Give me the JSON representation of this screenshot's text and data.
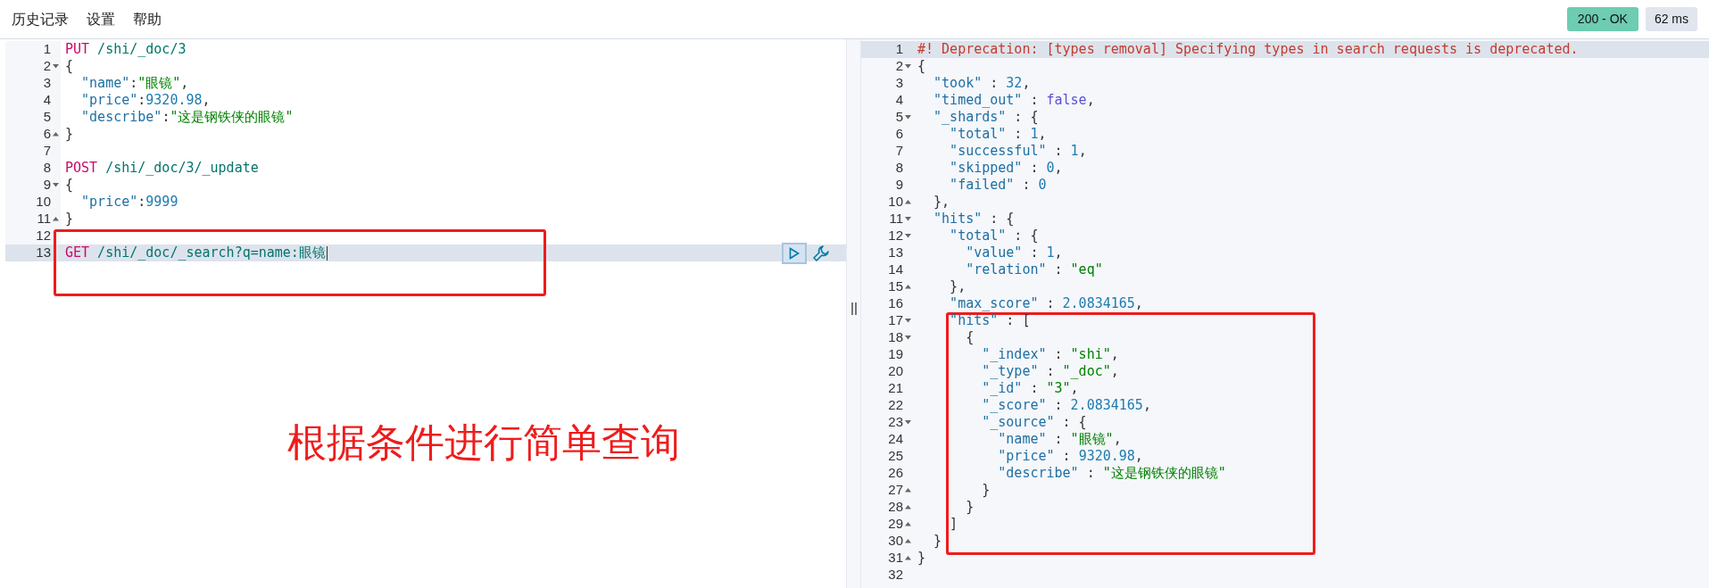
{
  "menu": [
    {
      "label": "历史记录"
    },
    {
      "label": "设置"
    },
    {
      "label": "帮助"
    }
  ],
  "status": {
    "code": "200 - OK",
    "time": "62 ms"
  },
  "request": {
    "lines": [
      {
        "num": "1",
        "active": false,
        "kind": "plain",
        "tokens": [
          {
            "kind": "method",
            "text": "PUT"
          },
          {
            "kind": "path",
            "text": " /shi/_doc/3"
          }
        ]
      },
      {
        "num": "2",
        "active": false,
        "kind": "fold-start",
        "tokens": [
          {
            "kind": "punct",
            "text": "{"
          }
        ]
      },
      {
        "num": "3",
        "active": false,
        "kind": "plain",
        "tokens": [
          {
            "kind": "key",
            "text": "  \"name\""
          },
          {
            "kind": "punct",
            "text": ":"
          },
          {
            "kind": "string",
            "text": "\"眼镜\""
          },
          {
            "kind": "punct",
            "text": ","
          }
        ]
      },
      {
        "num": "4",
        "active": false,
        "kind": "plain",
        "tokens": [
          {
            "kind": "key",
            "text": "  \"price\""
          },
          {
            "kind": "punct",
            "text": ":"
          },
          {
            "kind": "number",
            "text": "9320.98"
          },
          {
            "kind": "punct",
            "text": ","
          }
        ]
      },
      {
        "num": "5",
        "active": false,
        "kind": "plain",
        "tokens": [
          {
            "kind": "key",
            "text": "  \"describe\""
          },
          {
            "kind": "punct",
            "text": ":"
          },
          {
            "kind": "string",
            "text": "\"这是钢铁侠的眼镜\""
          }
        ]
      },
      {
        "num": "6",
        "active": false,
        "kind": "fold-end",
        "tokens": [
          {
            "kind": "punct",
            "text": "}"
          }
        ]
      },
      {
        "num": "7",
        "active": false,
        "kind": "plain"
      },
      {
        "num": "8",
        "active": false,
        "kind": "plain",
        "tokens": [
          {
            "kind": "method",
            "text": "POST"
          },
          {
            "kind": "path",
            "text": " /shi/_doc/3/_update"
          }
        ]
      },
      {
        "num": "9",
        "active": false,
        "kind": "fold-start",
        "tokens": [
          {
            "kind": "punct",
            "text": "{"
          }
        ]
      },
      {
        "num": "10",
        "active": false,
        "kind": "plain",
        "tokens": [
          {
            "kind": "key",
            "text": "  \"price\""
          },
          {
            "kind": "punct",
            "text": ":"
          },
          {
            "kind": "number",
            "text": "9999"
          }
        ]
      },
      {
        "num": "11",
        "active": false,
        "kind": "fold-end",
        "tokens": [
          {
            "kind": "punct",
            "text": "}"
          }
        ]
      },
      {
        "num": "12",
        "active": false,
        "kind": "plain"
      },
      {
        "num": "13",
        "active": true,
        "actions": true,
        "kind": "plain",
        "tokens": [
          {
            "kind": "method",
            "text": "GET"
          },
          {
            "kind": "path",
            "text": " /shi/_doc/_search?q=name:眼镜"
          }
        ]
      }
    ]
  },
  "response": {
    "lines": [
      {
        "num": "1",
        "active": true,
        "kind": "plain",
        "tokens": [
          {
            "kind": "comment",
            "text": "#! Deprecation: [types removal] Specifying types in search requests is deprecated."
          }
        ]
      },
      {
        "num": "2",
        "active": false,
        "kind": "fold-start",
        "tokens": [
          {
            "kind": "punct",
            "text": "{"
          }
        ]
      },
      {
        "num": "3",
        "active": false,
        "kind": "plain",
        "tokens": [
          {
            "kind": "key",
            "text": "  \"took\""
          },
          {
            "kind": "punct",
            "text": " : "
          },
          {
            "kind": "number",
            "text": "32"
          },
          {
            "kind": "punct",
            "text": ","
          }
        ]
      },
      {
        "num": "4",
        "active": false,
        "kind": "plain",
        "tokens": [
          {
            "kind": "key",
            "text": "  \"timed_out\""
          },
          {
            "kind": "punct",
            "text": " : "
          },
          {
            "kind": "bool",
            "text": "false"
          },
          {
            "kind": "punct",
            "text": ","
          }
        ]
      },
      {
        "num": "5",
        "active": false,
        "kind": "fold-start",
        "tokens": [
          {
            "kind": "key",
            "text": "  \"_shards\""
          },
          {
            "kind": "punct",
            "text": " : {"
          }
        ]
      },
      {
        "num": "6",
        "active": false,
        "kind": "plain",
        "tokens": [
          {
            "kind": "key",
            "text": "    \"total\""
          },
          {
            "kind": "punct",
            "text": " : "
          },
          {
            "kind": "number",
            "text": "1"
          },
          {
            "kind": "punct",
            "text": ","
          }
        ]
      },
      {
        "num": "7",
        "active": false,
        "kind": "plain",
        "tokens": [
          {
            "kind": "key",
            "text": "    \"successful\""
          },
          {
            "kind": "punct",
            "text": " : "
          },
          {
            "kind": "number",
            "text": "1"
          },
          {
            "kind": "punct",
            "text": ","
          }
        ]
      },
      {
        "num": "8",
        "active": false,
        "kind": "plain",
        "tokens": [
          {
            "kind": "key",
            "text": "    \"skipped\""
          },
          {
            "kind": "punct",
            "text": " : "
          },
          {
            "kind": "number",
            "text": "0"
          },
          {
            "kind": "punct",
            "text": ","
          }
        ]
      },
      {
        "num": "9",
        "active": false,
        "kind": "plain",
        "tokens": [
          {
            "kind": "key",
            "text": "    \"failed\""
          },
          {
            "kind": "punct",
            "text": " : "
          },
          {
            "kind": "number",
            "text": "0"
          }
        ]
      },
      {
        "num": "10",
        "active": false,
        "kind": "fold-end",
        "tokens": [
          {
            "kind": "punct",
            "text": "  },"
          }
        ]
      },
      {
        "num": "11",
        "active": false,
        "kind": "fold-start",
        "tokens": [
          {
            "kind": "key",
            "text": "  \"hits\""
          },
          {
            "kind": "punct",
            "text": " : {"
          }
        ]
      },
      {
        "num": "12",
        "active": false,
        "kind": "fold-start",
        "tokens": [
          {
            "kind": "key",
            "text": "    \"total\""
          },
          {
            "kind": "punct",
            "text": " : {"
          }
        ]
      },
      {
        "num": "13",
        "active": false,
        "kind": "plain",
        "tokens": [
          {
            "kind": "key",
            "text": "      \"value\""
          },
          {
            "kind": "punct",
            "text": " : "
          },
          {
            "kind": "number",
            "text": "1"
          },
          {
            "kind": "punct",
            "text": ","
          }
        ]
      },
      {
        "num": "14",
        "active": false,
        "kind": "plain",
        "tokens": [
          {
            "kind": "key",
            "text": "      \"relation\""
          },
          {
            "kind": "punct",
            "text": " : "
          },
          {
            "kind": "string",
            "text": "\"eq\""
          }
        ]
      },
      {
        "num": "15",
        "active": false,
        "kind": "fold-end",
        "tokens": [
          {
            "kind": "punct",
            "text": "    },"
          }
        ]
      },
      {
        "num": "16",
        "active": false,
        "kind": "plain",
        "tokens": [
          {
            "kind": "key",
            "text": "    \"max_score\""
          },
          {
            "kind": "punct",
            "text": " : "
          },
          {
            "kind": "number",
            "text": "2.0834165"
          },
          {
            "kind": "punct",
            "text": ","
          }
        ]
      },
      {
        "num": "17",
        "active": false,
        "kind": "fold-start",
        "tokens": [
          {
            "kind": "key",
            "text": "    \"hits\""
          },
          {
            "kind": "punct",
            "text": " : ["
          }
        ]
      },
      {
        "num": "18",
        "active": false,
        "kind": "fold-start",
        "tokens": [
          {
            "kind": "punct",
            "text": "      {"
          }
        ]
      },
      {
        "num": "19",
        "active": false,
        "kind": "plain",
        "tokens": [
          {
            "kind": "key",
            "text": "        \"_index\""
          },
          {
            "kind": "punct",
            "text": " : "
          },
          {
            "kind": "string",
            "text": "\"shi\""
          },
          {
            "kind": "punct",
            "text": ","
          }
        ]
      },
      {
        "num": "20",
        "active": false,
        "kind": "plain",
        "tokens": [
          {
            "kind": "key",
            "text": "        \"_type\""
          },
          {
            "kind": "punct",
            "text": " : "
          },
          {
            "kind": "string",
            "text": "\"_doc\""
          },
          {
            "kind": "punct",
            "text": ","
          }
        ]
      },
      {
        "num": "21",
        "active": false,
        "kind": "plain",
        "tokens": [
          {
            "kind": "key",
            "text": "        \"_id\""
          },
          {
            "kind": "punct",
            "text": " : "
          },
          {
            "kind": "string",
            "text": "\"3\""
          },
          {
            "kind": "punct",
            "text": ","
          }
        ]
      },
      {
        "num": "22",
        "active": false,
        "kind": "plain",
        "tokens": [
          {
            "kind": "key",
            "text": "        \"_score\""
          },
          {
            "kind": "punct",
            "text": " : "
          },
          {
            "kind": "number",
            "text": "2.0834165"
          },
          {
            "kind": "punct",
            "text": ","
          }
        ]
      },
      {
        "num": "23",
        "active": false,
        "kind": "fold-start",
        "tokens": [
          {
            "kind": "key",
            "text": "        \"_source\""
          },
          {
            "kind": "punct",
            "text": " : {"
          }
        ]
      },
      {
        "num": "24",
        "active": false,
        "kind": "plain",
        "tokens": [
          {
            "kind": "key",
            "text": "          \"name\""
          },
          {
            "kind": "punct",
            "text": " : "
          },
          {
            "kind": "string",
            "text": "\"眼镜\""
          },
          {
            "kind": "punct",
            "text": ","
          }
        ]
      },
      {
        "num": "25",
        "active": false,
        "kind": "plain",
        "tokens": [
          {
            "kind": "key",
            "text": "          \"price\""
          },
          {
            "kind": "punct",
            "text": " : "
          },
          {
            "kind": "number",
            "text": "9320.98"
          },
          {
            "kind": "punct",
            "text": ","
          }
        ]
      },
      {
        "num": "26",
        "active": false,
        "kind": "plain",
        "tokens": [
          {
            "kind": "key",
            "text": "          \"describe\""
          },
          {
            "kind": "punct",
            "text": " : "
          },
          {
            "kind": "string",
            "text": "\"这是钢铁侠的眼镜\""
          }
        ]
      },
      {
        "num": "27",
        "active": false,
        "kind": "fold-end",
        "tokens": [
          {
            "kind": "punct",
            "text": "        }"
          }
        ]
      },
      {
        "num": "28",
        "active": false,
        "kind": "fold-end",
        "tokens": [
          {
            "kind": "punct",
            "text": "      }"
          }
        ]
      },
      {
        "num": "29",
        "active": false,
        "kind": "fold-end",
        "tokens": [
          {
            "kind": "punct",
            "text": "    ]"
          }
        ]
      },
      {
        "num": "30",
        "active": false,
        "kind": "fold-end",
        "tokens": [
          {
            "kind": "punct",
            "text": "  }"
          }
        ]
      },
      {
        "num": "31",
        "active": false,
        "kind": "fold-end",
        "tokens": [
          {
            "kind": "punct",
            "text": "}"
          }
        ]
      },
      {
        "num": "32",
        "active": false,
        "kind": "plain"
      }
    ]
  },
  "annotation": {
    "text": "根据条件进行简单查询"
  }
}
